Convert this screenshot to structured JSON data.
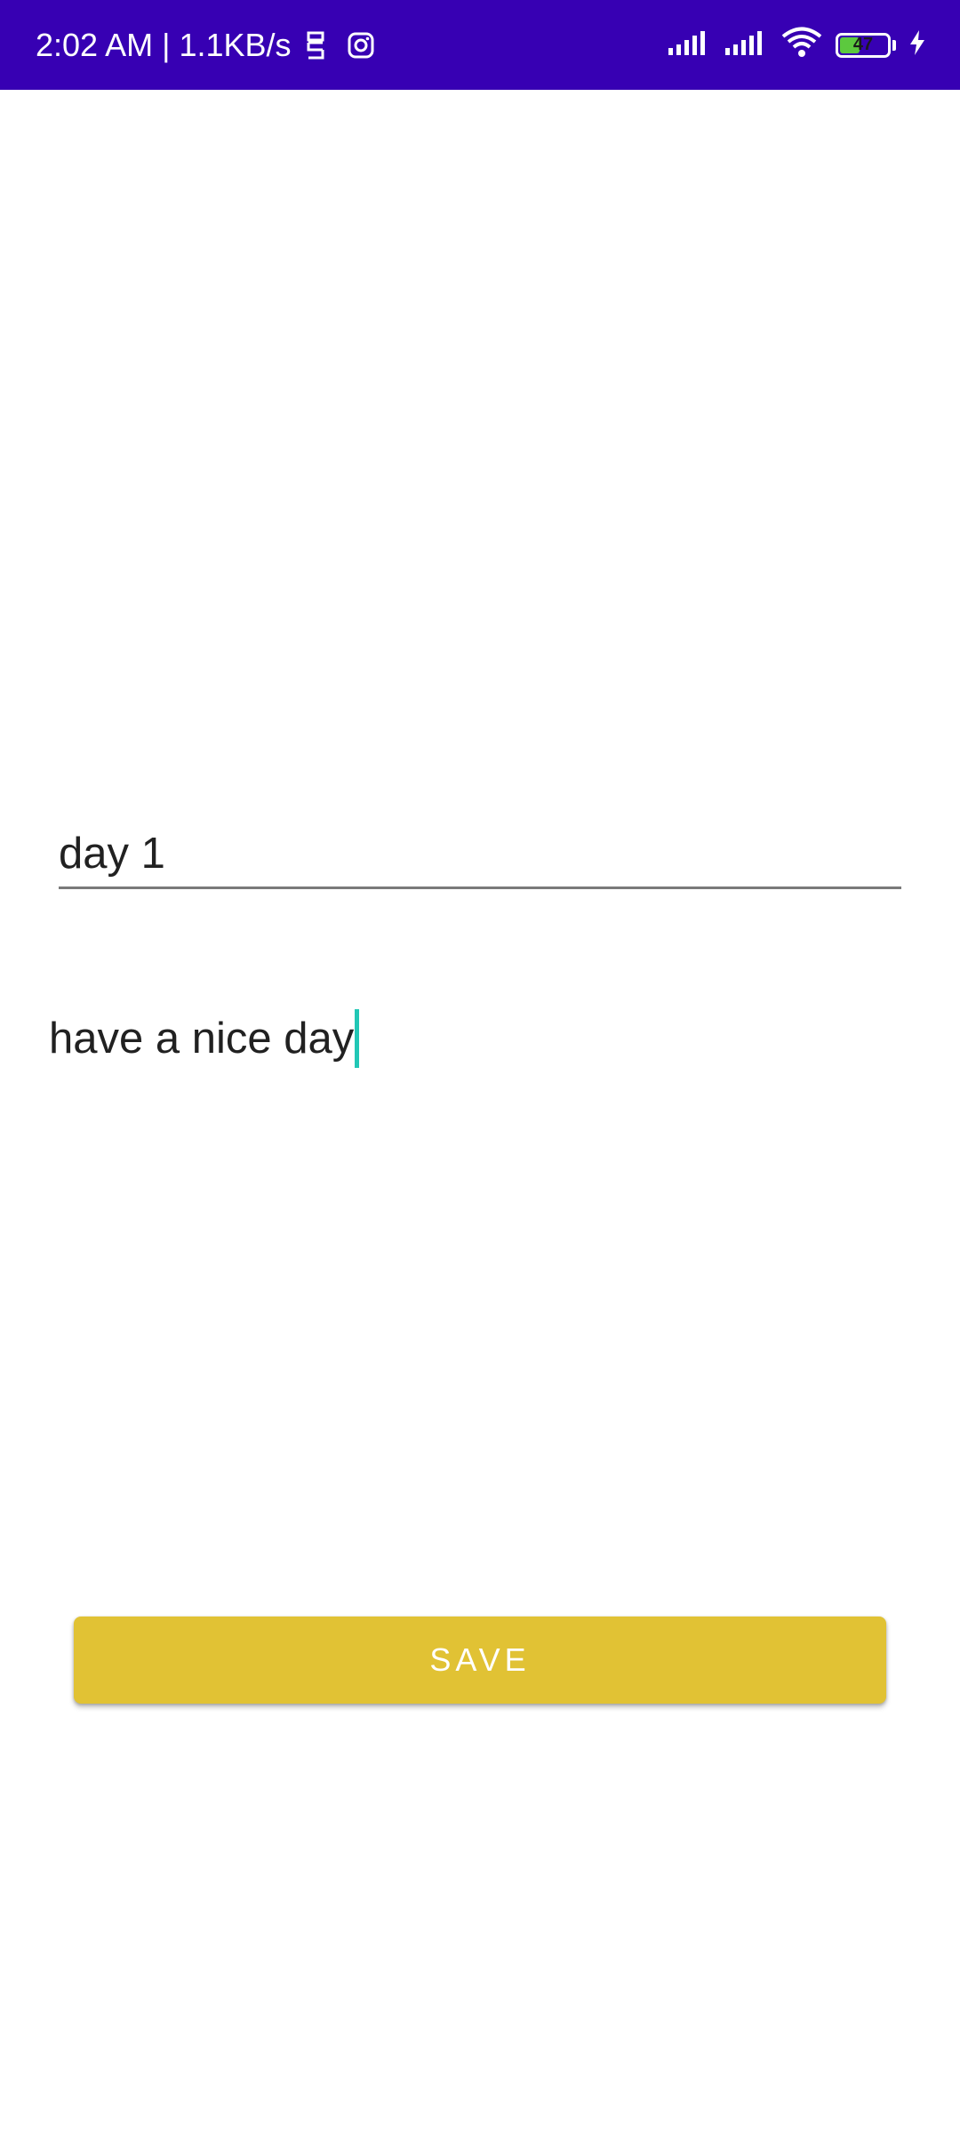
{
  "status_bar": {
    "time_speed": "2:02 AM | 1.1KB/s",
    "battery_level": "47",
    "background_color": "#3700b3",
    "icons": [
      "sim-toolkit-icon",
      "instagram-icon",
      "signal-icon",
      "signal-icon",
      "wifi-icon",
      "battery-icon",
      "charging-icon"
    ]
  },
  "editor": {
    "title_value": "day 1",
    "body_value": "have a nice day",
    "cursor_color": "#21c7b5"
  },
  "actions": {
    "save_label": "SAVE",
    "save_color": "#e1c234"
  }
}
